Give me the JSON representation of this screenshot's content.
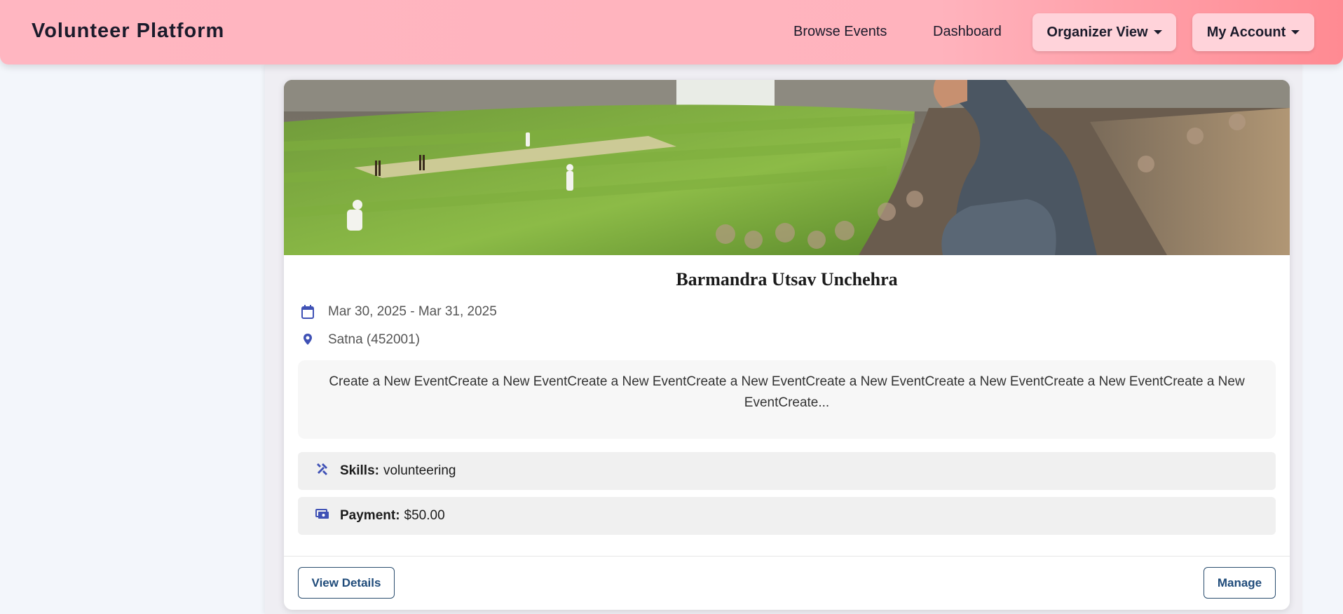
{
  "navbar": {
    "brand": "Volunteer Platform",
    "links": [
      "Browse Events",
      "Dashboard"
    ],
    "organizer_label": "Organizer View",
    "account_label": "My Account"
  },
  "event": {
    "title": "Barmandra Utsav Unchehra",
    "dates": "Mar 30, 2025 - Mar 31, 2025",
    "location": "Satna (452001)",
    "description": "Create a New EventCreate a New EventCreate a New EventCreate a New EventCreate a New EventCreate a New EventCreate a New EventCreate a New EventCreate...",
    "skills_label": "Skills:",
    "skills_value": "volunteering",
    "payment_label": "Payment:",
    "payment_value": "$50.00",
    "image_subject": "cricket stadium with spectator"
  },
  "actions": {
    "view_details": "View Details",
    "manage": "Manage"
  },
  "colors": {
    "navbar_gradient_start": "#ffb6c1",
    "navbar_gradient_end": "#ff8a92",
    "icon_accent": "#3f51b5",
    "button_text": "#1f4b7a"
  },
  "icons": [
    "calendar-icon",
    "location-pin-icon",
    "tools-icon",
    "payment-icon"
  ]
}
